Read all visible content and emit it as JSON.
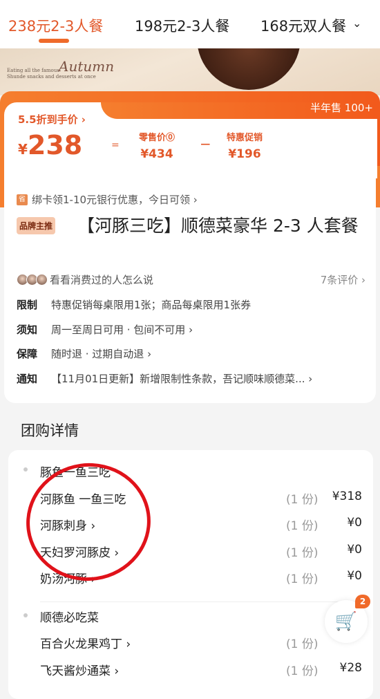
{
  "tabs": [
    {
      "label": "238元2-3人餐",
      "active": true
    },
    {
      "label": "198元2-3人餐"
    },
    {
      "label": "168元双人餐"
    }
  ],
  "tabs_more_icon": "chevron-down-icon",
  "banner": {
    "text_line1": "Eating all the famous",
    "text_line2": "Shunde snacks and desserts at once",
    "script": "Autumn"
  },
  "price": {
    "sold": "半年售 100+",
    "discount": "5.5折到手价 ›",
    "currency": "¥",
    "final": "238",
    "equals": "=",
    "retail_label": "零售价⓪",
    "retail": "¥434",
    "minus": "−",
    "promo_label": "特惠促销",
    "promo": "¥196"
  },
  "colors": {
    "accent": "#e2582a",
    "orange": "#f25a1c",
    "annotation": "#e0121a"
  },
  "bank": {
    "icon": "省",
    "text": "绑卡领1-10元银行优惠，今日可领 ›"
  },
  "product": {
    "badge": "品牌主推",
    "title": "【河豚三吃】顺德菜豪华 2-3 人套餐"
  },
  "reviews": {
    "prompt": "看看消费过的人怎么说",
    "count": "7条评价 ›"
  },
  "info": [
    {
      "label": "限制",
      "text": "特惠促销每桌限用1张；商品每桌限用1张券"
    },
    {
      "label": "须知",
      "text": "周一至周日可用 · 包间不可用 ›"
    },
    {
      "label": "保障",
      "text": "随时退 · 过期自动退 ›"
    },
    {
      "label": "通知",
      "text": "【11月01日更新】新增限制性条款，吾记顺味顺德菜... ›"
    }
  ],
  "section_title": "团购详情",
  "groups": [
    {
      "name": "豚鱼一鱼三吃",
      "items": [
        {
          "name": "河豚鱼 一鱼三吃",
          "qty": "(1 份)",
          "price": "¥318"
        },
        {
          "name": "河豚刺身 ›",
          "qty": "(1 份)",
          "price": "¥0"
        },
        {
          "name": "天妇罗河豚皮 ›",
          "qty": "(1 份)",
          "price": "¥0"
        },
        {
          "name": "奶汤河豚 ›",
          "qty": "(1 份)",
          "price": "¥0"
        }
      ]
    },
    {
      "name": "顺德必吃菜",
      "items": [
        {
          "name": "百合火龙果鸡丁 ›",
          "qty": "(1 份)",
          "price": ""
        },
        {
          "name": "飞天酱炒通菜 ›",
          "qty": "(1 份)",
          "price": "¥28"
        }
      ]
    }
  ],
  "cart": {
    "icon": "cart-icon",
    "badge": "2"
  }
}
